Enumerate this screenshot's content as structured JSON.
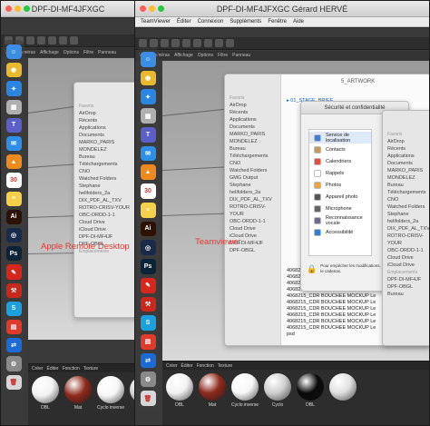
{
  "left_window": {
    "title": "DPF-DI-MF4JFXGC",
    "overlay_label": "Apple Remote Desktop",
    "c4d_menu": [
      "Vue",
      "Caméras",
      "Affichage",
      "Options",
      "Filtre",
      "Panneau"
    ],
    "finder_sidebar": [
      "Favoris",
      "AirDrop",
      "Récents",
      "Applications",
      "Documents",
      "MARKO_PARIS",
      "MONDELEZ",
      "Bureau",
      "Téléchargements",
      "CNO",
      "Watched Folders",
      "Stephane",
      "helifolders_2a",
      "DIX_PDF_AL_TXV",
      "ROTRO-CRISV-YOUR",
      "OBC-ORDD-1-1",
      "Cloud Drive",
      "iCloud Drive",
      "DPF-DI-MF4JF",
      "DPF-OBGL",
      "Emplacements"
    ],
    "material_tabs": [
      "Créer",
      "Éditer",
      "Fonction",
      "Texture"
    ],
    "materials": [
      {
        "label": "DBL",
        "color": "#f2f2f2"
      },
      {
        "label": "Mat",
        "color": "#8e2a1c"
      },
      {
        "label": "Cyclo inverse",
        "color": "#f7f7f7"
      },
      {
        "label": "Cyclo",
        "color": "#cfcfcf"
      }
    ]
  },
  "right_window": {
    "title": "DPF-DI-MF4JFXGC Gérard HERVÉ",
    "overlay_label": "Teamviewer",
    "menubar": [
      "TeamViewer",
      "Éditer",
      "Connexion",
      "Suppléments",
      "Fenêtre",
      "Aide"
    ],
    "c4d_menu": [
      "Vue",
      "Caméras",
      "Affichage",
      "Options",
      "Filtre",
      "Panneau"
    ],
    "finder_path": "5_ARTWORK",
    "finder_folder": "01_STAGE_BRIEF",
    "finder_sidebar": [
      "Favoris",
      "AirDrop",
      "Récents",
      "Applications",
      "Documents",
      "MARKO_PARIS",
      "MONDELEZ",
      "Bureau",
      "Téléchargements",
      "CNO",
      "Watched Folders",
      "GMG Output",
      "Stephane",
      "helifolders_2a",
      "DIX_PDF_AL_TXV",
      "ROTRO-CRISV-YOUR",
      "OBC-ORDD-1-1",
      "Cloud Drive",
      "iCloud Drive",
      "DPF-DI-MF4JF",
      "DPF-OBGL"
    ],
    "files": [
      "4068215_CDR BOUCHEE MOCKUP Le",
      "4068215_CDR BOUCHEE MOCKUP Le",
      "4068215_CDR BOUCHEE MOCKUP Le",
      "4068215_CDR BOUCHEE MOCKUP Le",
      "4068215_CDR BOUCHEE MOCKUP Le",
      "4068215_CDR BOUCHEE MOCKUP Le",
      "4068215_CDR BOUCHEE MOCKUP Le",
      "4068215_CDR BOUCHEE MOCKUP Le",
      "4068215_CDR BOUCHEE MOCKUP Le",
      "4068215_CDR BOUCHEE MOCKUP Le",
      "psd"
    ],
    "prefs_title": "Sécurité et confidentialité",
    "prefs_tab": "Général",
    "prefs_items": [
      {
        "label": "Service de localisation",
        "color": "#3d7be0"
      },
      {
        "label": "Contacts",
        "color": "#c79a5b"
      },
      {
        "label": "Calendriers",
        "color": "#e84a3f"
      },
      {
        "label": "Rappels",
        "color": "#ffffff"
      },
      {
        "label": "Photos",
        "color": "#f0a33a"
      },
      {
        "label": "Appareil photo",
        "color": "#555555"
      },
      {
        "label": "Microphone",
        "color": "#666666"
      },
      {
        "label": "Reconnaissance vocale",
        "color": "#6c6c8c"
      },
      {
        "label": "Accessibilité",
        "color": "#2f7ee0"
      }
    ],
    "lock_text": "Pour empêcher les modifications, cliquez sur le cadenas.",
    "right_sidebar": [
      "Favoris",
      "AirDrop",
      "Récents",
      "Applications",
      "Documents",
      "MARKO_PARIS",
      "MONDELEZ",
      "Bureau",
      "Téléchargements",
      "CNO",
      "Watched Folders",
      "Stephane",
      "helifolders_2a",
      "DIX_PDF_AL_TXV",
      "ROTRO-CRISV-YOUR",
      "OBC-ORDD-1-1",
      "Cloud Drive",
      "iCloud Drive",
      "Emplacements",
      "DPF-DI-MF4JF",
      "DPF-OBGL",
      "Bureau"
    ],
    "material_tabs": [
      "Créer",
      "Éditer",
      "Fonction",
      "Texture"
    ],
    "materials": [
      {
        "label": "DBL",
        "color": "#f2f2f2"
      },
      {
        "label": "Mat",
        "color": "#8e2a1c"
      },
      {
        "label": "Cyclo inverse",
        "color": "#f7f7f7"
      },
      {
        "label": "Cyclo",
        "color": "#cfcfcf"
      },
      {
        "label": "DBL",
        "color": "#0a0a0a"
      },
      {
        "label": "",
        "color": "#e0e0e0"
      }
    ]
  },
  "dock_icons": [
    {
      "name": "finder",
      "color": "#3a8ee6",
      "glyph": "☺"
    },
    {
      "name": "chrome",
      "color": "#e8b92c",
      "glyph": "◉"
    },
    {
      "name": "safari",
      "color": "#2a86e0",
      "glyph": "✦"
    },
    {
      "name": "launchpad",
      "color": "#b0b0b0",
      "glyph": "▦"
    },
    {
      "name": "teams",
      "color": "#5b5fc7",
      "glyph": "T"
    },
    {
      "name": "mail",
      "color": "#2e8fe8",
      "glyph": "✉"
    },
    {
      "name": "vlc",
      "color": "#f08a1c",
      "glyph": "▲"
    },
    {
      "name": "calendar",
      "color": "#ffffff",
      "glyph": "30"
    },
    {
      "name": "notes",
      "color": "#f5d04a",
      "glyph": "≡"
    },
    {
      "name": "illustrator",
      "color": "#2b1205",
      "glyph": "Ai"
    },
    {
      "name": "cinema4d",
      "color": "#1a2a4a",
      "glyph": "◎"
    },
    {
      "name": "photoshop",
      "color": "#0a2338",
      "glyph": "Ps"
    },
    {
      "name": "acrobat",
      "color": "#d9261c",
      "glyph": "✎"
    },
    {
      "name": "toolbox",
      "color": "#c8281e",
      "glyph": "⚒"
    },
    {
      "name": "skype",
      "color": "#1ba0e0",
      "glyph": "S"
    },
    {
      "name": "pdf-viewer",
      "color": "#e23a2a",
      "glyph": "▤"
    },
    {
      "name": "teamviewer",
      "color": "#1a6bd6",
      "glyph": "⇄"
    },
    {
      "name": "preferences",
      "color": "#8a8a8a",
      "glyph": "⚙"
    },
    {
      "name": "trash",
      "color": "#d7d7d7",
      "glyph": "🗑"
    }
  ]
}
